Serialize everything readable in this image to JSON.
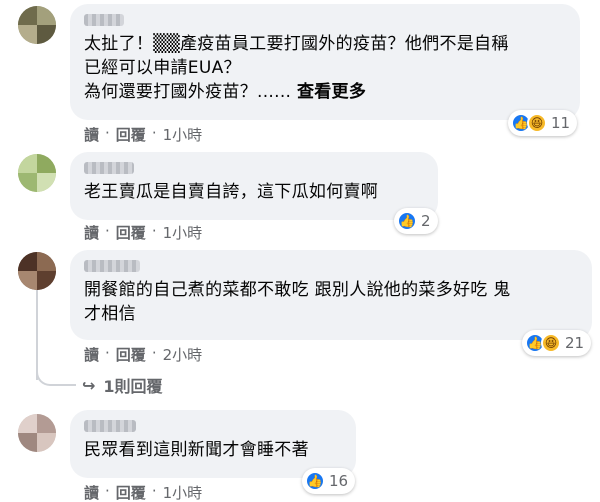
{
  "comments": [
    {
      "text": "太扯了！▒▒產疫苗員工要打國外的疫苗？他們不是自稱\n已經可以申請EUA？\n為何還要打國外疫苗？......",
      "see_more": "查看更多",
      "actions": {
        "read": "讀",
        "reply": "回覆",
        "time": "1小時"
      },
      "reaction_count": "11",
      "reaction_icons": [
        "like-icon",
        "haha-icon"
      ]
    },
    {
      "text": "老王賣瓜是自賣自誇，這下瓜如何賣啊",
      "actions": {
        "read": "讀",
        "reply": "回覆",
        "time": "1小時"
      },
      "reaction_count": "2",
      "reaction_icons": [
        "like-icon"
      ]
    },
    {
      "text": "開餐館的自己煮的菜都不敢吃 跟別人說他的菜多好吃 鬼\n才相信",
      "actions": {
        "read": "讀",
        "reply": "回覆",
        "time": "2小時"
      },
      "reaction_count": "21",
      "reaction_icons": [
        "like-icon",
        "haha-icon"
      ]
    },
    {
      "text": "民眾看到這則新聞才會睡不著",
      "actions": {
        "read": "讀",
        "reply": "回覆",
        "time": "1小時"
      },
      "reaction_count": "16",
      "reaction_icons": [
        "like-icon"
      ]
    }
  ],
  "reply_link": "1則回覆",
  "colors": {
    "bubble": "#f0f2f5",
    "like": "#1877f2",
    "haha": "#f7b928",
    "meta": "#65676b"
  }
}
